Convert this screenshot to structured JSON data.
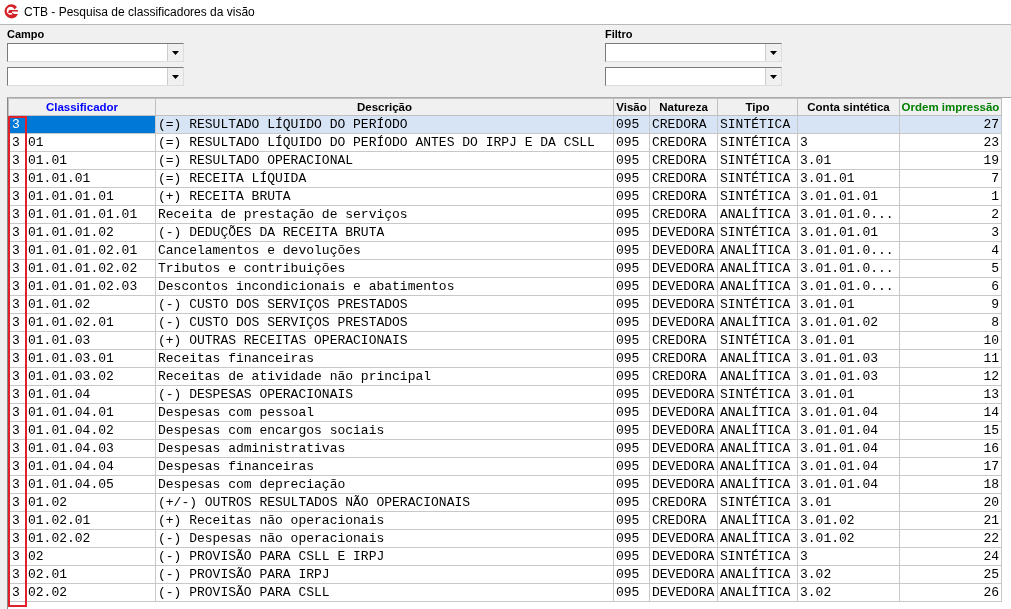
{
  "window": {
    "title": "CTB - Pesquisa de classificadores da visão"
  },
  "filters": [
    {
      "label": "Campo"
    },
    {
      "label": "Filtro"
    }
  ],
  "table": {
    "highlight_root_column": true,
    "columns": [
      {
        "label": "Classificador",
        "color": "#0000ff"
      },
      {
        "label": "Descrição",
        "color": "#000000"
      },
      {
        "label": "Visão",
        "color": "#000000"
      },
      {
        "label": "Natureza",
        "color": "#000000"
      },
      {
        "label": "Tipo",
        "color": "#000000"
      },
      {
        "label": "Conta sintética",
        "color": "#000000"
      },
      {
        "label": "Ordem impressão",
        "color": "#008000"
      }
    ],
    "rows": [
      {
        "selected": true,
        "cells": [
          {
            "root": "3"
          },
          "(=) RESULTADO LÍQUIDO DO PERÍODO",
          "095",
          "CREDORA",
          "SINTÉTICA",
          "",
          "27"
        ]
      },
      {
        "selected": false,
        "cells": [
          {
            "root": "3",
            "code": "01"
          },
          "(=) RESULTADO LÍQUIDO DO PERÍODO ANTES DO IRPJ E DA CSLL",
          "095",
          "CREDORA",
          "SINTÉTICA",
          "3",
          "23"
        ]
      },
      {
        "selected": false,
        "cells": [
          {
            "root": "3",
            "code": "01.01"
          },
          "(=) RESULTADO OPERACIONAL",
          "095",
          "CREDORA",
          "SINTÉTICA",
          "3.01",
          "19"
        ]
      },
      {
        "selected": false,
        "cells": [
          {
            "root": "3",
            "code": "01.01.01"
          },
          "(=) RECEITA LÍQUIDA",
          "095",
          "CREDORA",
          "SINTÉTICA",
          "3.01.01",
          "7"
        ]
      },
      {
        "selected": false,
        "cells": [
          {
            "root": "3",
            "code": "01.01.01.01"
          },
          "(+) RECEITA BRUTA",
          "095",
          "CREDORA",
          "SINTÉTICA",
          "3.01.01.01",
          "1"
        ]
      },
      {
        "selected": false,
        "cells": [
          {
            "root": "3",
            "code": "01.01.01.01.01"
          },
          "Receita de prestação de serviços",
          "095",
          "CREDORA",
          "ANALÍTICA",
          "3.01.01.0...",
          "2"
        ]
      },
      {
        "selected": false,
        "cells": [
          {
            "root": "3",
            "code": "01.01.01.02"
          },
          "(-) DEDUÇÕES DA RECEITA BRUTA",
          "095",
          "DEVEDORA",
          "SINTÉTICA",
          "3.01.01.01",
          "3"
        ]
      },
      {
        "selected": false,
        "cells": [
          {
            "root": "3",
            "code": "01.01.01.02.01"
          },
          "Cancelamentos e devoluções",
          "095",
          "DEVEDORA",
          "ANALÍTICA",
          "3.01.01.0...",
          "4"
        ]
      },
      {
        "selected": false,
        "cells": [
          {
            "root": "3",
            "code": "01.01.01.02.02"
          },
          "Tributos e contribuições",
          "095",
          "DEVEDORA",
          "ANALÍTICA",
          "3.01.01.0...",
          "5"
        ]
      },
      {
        "selected": false,
        "cells": [
          {
            "root": "3",
            "code": "01.01.01.02.03"
          },
          "Descontos incondicionais e abatimentos",
          "095",
          "DEVEDORA",
          "ANALÍTICA",
          "3.01.01.0...",
          "6"
        ]
      },
      {
        "selected": false,
        "cells": [
          {
            "root": "3",
            "code": "01.01.02"
          },
          "(-) CUSTO DOS SERVIÇOS PRESTADOS",
          "095",
          "DEVEDORA",
          "SINTÉTICA",
          "3.01.01",
          "9"
        ]
      },
      {
        "selected": false,
        "cells": [
          {
            "root": "3",
            "code": "01.01.02.01"
          },
          "(-) CUSTO DOS SERVIÇOS PRESTADOS",
          "095",
          "DEVEDORA",
          "ANALÍTICA",
          "3.01.01.02",
          "8"
        ]
      },
      {
        "selected": false,
        "cells": [
          {
            "root": "3",
            "code": "01.01.03"
          },
          "(+) OUTRAS RECEITAS OPERACIONAIS",
          "095",
          "CREDORA",
          "SINTÉTICA",
          "3.01.01",
          "10"
        ]
      },
      {
        "selected": false,
        "cells": [
          {
            "root": "3",
            "code": "01.01.03.01"
          },
          "Receitas financeiras",
          "095",
          "CREDORA",
          "ANALÍTICA",
          "3.01.01.03",
          "11"
        ]
      },
      {
        "selected": false,
        "cells": [
          {
            "root": "3",
            "code": "01.01.03.02"
          },
          "Receitas de atividade não principal",
          "095",
          "CREDORA",
          "ANALÍTICA",
          "3.01.01.03",
          "12"
        ]
      },
      {
        "selected": false,
        "cells": [
          {
            "root": "3",
            "code": "01.01.04"
          },
          "(-) DESPESAS OPERACIONAIS",
          "095",
          "DEVEDORA",
          "SINTÉTICA",
          "3.01.01",
          "13"
        ]
      },
      {
        "selected": false,
        "cells": [
          {
            "root": "3",
            "code": "01.01.04.01"
          },
          "Despesas com pessoal",
          "095",
          "DEVEDORA",
          "ANALÍTICA",
          "3.01.01.04",
          "14"
        ]
      },
      {
        "selected": false,
        "cells": [
          {
            "root": "3",
            "code": "01.01.04.02"
          },
          "Despesas com encargos sociais",
          "095",
          "DEVEDORA",
          "ANALÍTICA",
          "3.01.01.04",
          "15"
        ]
      },
      {
        "selected": false,
        "cells": [
          {
            "root": "3",
            "code": "01.01.04.03"
          },
          "Despesas administrativas",
          "095",
          "DEVEDORA",
          "ANALÍTICA",
          "3.01.01.04",
          "16"
        ]
      },
      {
        "selected": false,
        "cells": [
          {
            "root": "3",
            "code": "01.01.04.04"
          },
          "Despesas financeiras",
          "095",
          "DEVEDORA",
          "ANALÍTICA",
          "3.01.01.04",
          "17"
        ]
      },
      {
        "selected": false,
        "cells": [
          {
            "root": "3",
            "code": "01.01.04.05"
          },
          "Despesas com depreciação",
          "095",
          "DEVEDORA",
          "ANALÍTICA",
          "3.01.01.04",
          "18"
        ]
      },
      {
        "selected": false,
        "cells": [
          {
            "root": "3",
            "code": "01.02"
          },
          "(+/-) OUTROS RESULTADOS NÃO OPERACIONAIS",
          "095",
          "CREDORA",
          "SINTÉTICA",
          "3.01",
          "20"
        ]
      },
      {
        "selected": false,
        "cells": [
          {
            "root": "3",
            "code": "01.02.01"
          },
          "(+) Receitas não operacionais",
          "095",
          "CREDORA",
          "ANALÍTICA",
          "3.01.02",
          "21"
        ]
      },
      {
        "selected": false,
        "cells": [
          {
            "root": "3",
            "code": "01.02.02"
          },
          "(-) Despesas não operacionais",
          "095",
          "DEVEDORA",
          "ANALÍTICA",
          "3.01.02",
          "22"
        ]
      },
      {
        "selected": false,
        "cells": [
          {
            "root": "3",
            "code": "02"
          },
          "(-) PROVISÃO PARA CSLL E IRPJ",
          "095",
          "DEVEDORA",
          "SINTÉTICA",
          "3",
          "24"
        ]
      },
      {
        "selected": false,
        "cells": [
          {
            "root": "3",
            "code": "02.01"
          },
          "(-) PROVISÃO PARA IRPJ",
          "095",
          "DEVEDORA",
          "ANALÍTICA",
          "3.02",
          "25"
        ]
      },
      {
        "selected": false,
        "cells": [
          {
            "root": "3",
            "code": "02.02"
          },
          "(-) PROVISÃO PARA CSLL",
          "095",
          "DEVEDORA",
          "ANALÍTICA",
          "3.02",
          "26"
        ]
      }
    ]
  }
}
